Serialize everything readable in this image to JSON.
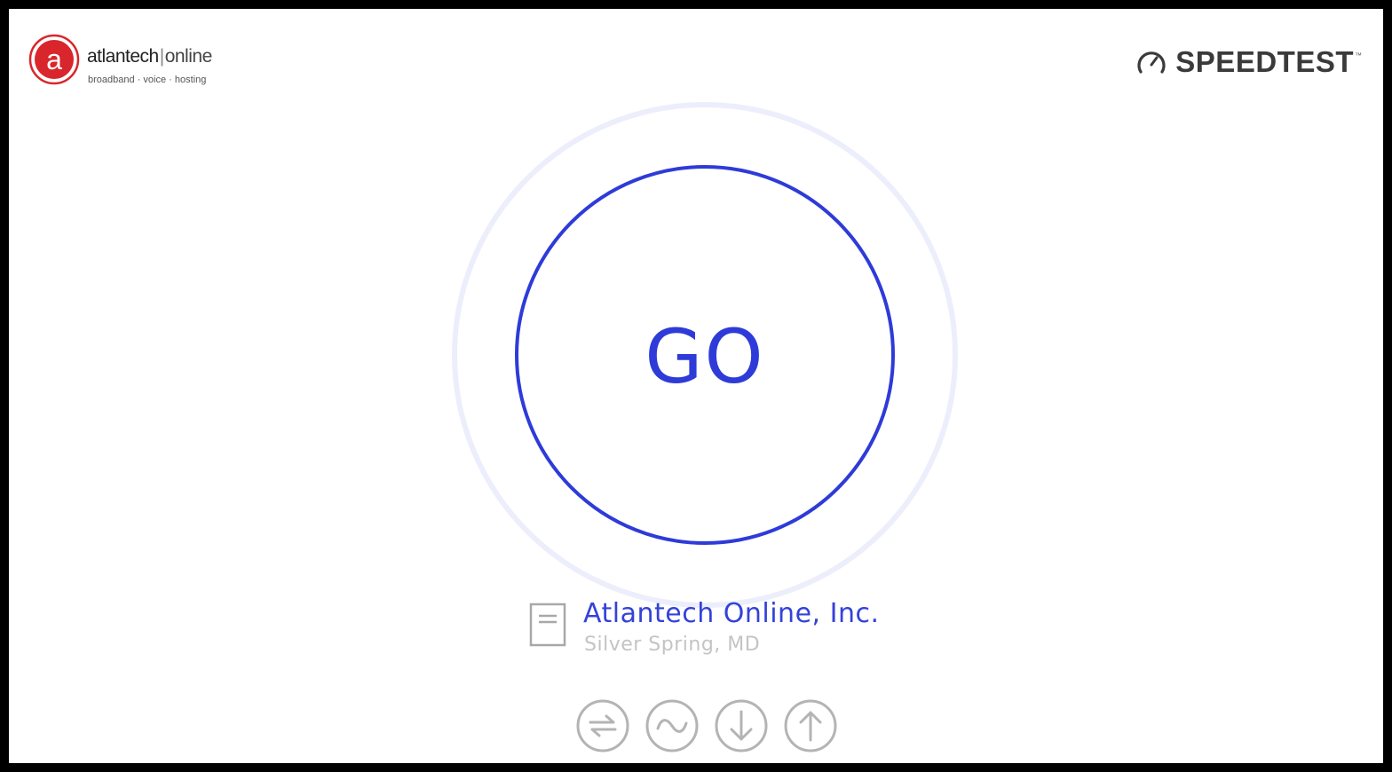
{
  "brand": {
    "logo_letter": "a",
    "name_primary": "atlantech",
    "name_separator": "|",
    "name_secondary": "online",
    "tagline": "broadband · voice · hosting",
    "logo_color": "#d9262c"
  },
  "speedtest_logo": {
    "text": "SPEEDTEST",
    "trademark": "™",
    "icon": "gauge-icon"
  },
  "go_button": {
    "label": "GO",
    "accent_color": "#2e3bd8"
  },
  "server": {
    "icon": "server-icon",
    "name": "Atlantech Online, Inc.",
    "location": "Silver Spring, MD"
  },
  "metric_icons": [
    {
      "name": "ping-icon"
    },
    {
      "name": "jitter-icon"
    },
    {
      "name": "download-icon"
    },
    {
      "name": "upload-icon"
    }
  ]
}
